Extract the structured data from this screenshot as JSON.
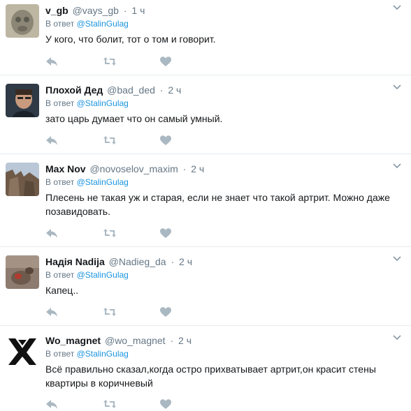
{
  "reply_prefix": "В ответ",
  "tweets": [
    {
      "name": "v_gb",
      "handle": "@vays_gb",
      "time": "1 ч",
      "reply_to": "@StalinGulag",
      "text": "У кого, что болит, тот о том и говорит."
    },
    {
      "name": "Плохой Дед",
      "handle": "@bad_ded",
      "time": "2 ч",
      "reply_to": "@StalinGulag",
      "text": "зато царь думает что он самый умный."
    },
    {
      "name": "Max Nov",
      "handle": "@novoselov_maxim",
      "time": "2 ч",
      "reply_to": "@StalinGulag",
      "text_line1": "Плесень не такая уж и старая, если не знает что такой артрит. Можно даже",
      "text_line2": "позавидовать."
    },
    {
      "name": "Надія Nadija",
      "handle": "@Nadieg_da",
      "time": "2 ч",
      "reply_to": "@StalinGulag",
      "text": "Капец.."
    },
    {
      "name": "Wo_magnet",
      "handle": "@wo_magnet",
      "time": "2 ч",
      "reply_to": "@StalinGulag",
      "text_line1": "Всё правильно сказал,когда остро прихватывает артрит,он красит стены",
      "text_line2": "квартиры в коричневый"
    }
  ],
  "icons": {
    "reply": "reply-icon",
    "retweet": "retweet-icon",
    "like": "heart-icon",
    "more": "chevron-down-icon"
  },
  "colors": {
    "name": "#14171a",
    "meta": "#657786",
    "mention": "#1b95e0",
    "action_icon": "#aab8c2",
    "divider": "#e6ecf0"
  }
}
